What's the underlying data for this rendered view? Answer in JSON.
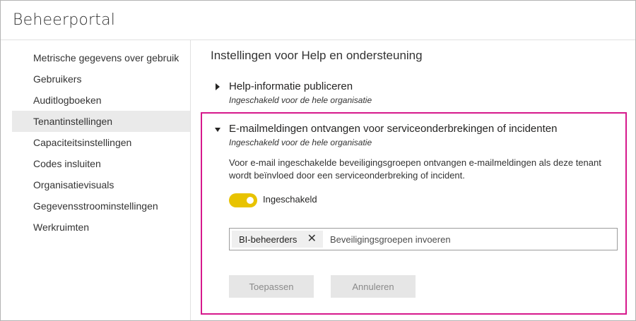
{
  "portal": {
    "title": "Beheerportal"
  },
  "sidebar": {
    "items": [
      {
        "label": "Metrische gegevens over gebruik"
      },
      {
        "label": "Gebruikers"
      },
      {
        "label": "Auditlogboeken"
      },
      {
        "label": "Tenantinstellingen",
        "active": true
      },
      {
        "label": "Capaciteitsinstellingen"
      },
      {
        "label": "Codes insluiten"
      },
      {
        "label": "Organisatievisuals"
      },
      {
        "label": "Gegevensstroominstellingen"
      },
      {
        "label": "Werkruimten"
      }
    ]
  },
  "main": {
    "section_title": "Instellingen voor Help en ondersteuning",
    "settings": [
      {
        "title": "Help-informatie publiceren",
        "subtitle": "Ingeschakeld voor de hele organisatie",
        "expanded": false
      },
      {
        "title": "E-mailmeldingen ontvangen voor serviceonderbrekingen of incidenten",
        "subtitle": "Ingeschakeld voor de hele organisatie",
        "expanded": true,
        "description": "Voor e-mail ingeschakelde beveiligingsgroepen ontvangen e-mailmeldingen als deze tenant wordt beïnvloed door een serviceonderbreking of incident.",
        "toggle": {
          "state": "on",
          "label": "Ingeschakeld"
        },
        "groups_input": {
          "chips": [
            "BI-beheerders"
          ],
          "placeholder": "Beveiligingsgroepen invoeren"
        },
        "apply_label": "Toepassen",
        "cancel_label": "Annuleren"
      }
    ]
  },
  "colors": {
    "highlight": "#d6198c",
    "toggle_on": "#e8c300",
    "sidebar_active_bg": "#eaeaea"
  }
}
